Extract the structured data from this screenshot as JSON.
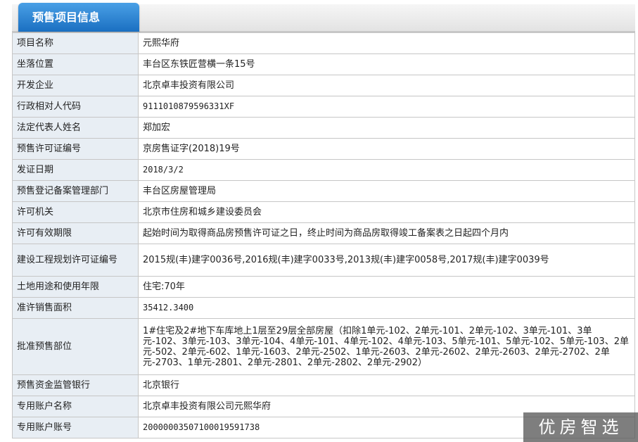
{
  "section": {
    "title": "预售项目信息"
  },
  "rows": [
    {
      "label": "项目名称",
      "value": "元熙华府"
    },
    {
      "label": "坐落位置",
      "value": "丰台区东铁匠营横一条15号"
    },
    {
      "label": "开发企业",
      "value": "北京卓丰投资有限公司"
    },
    {
      "label": "行政相对人代码",
      "value": "9111010879596331XF"
    },
    {
      "label": "法定代表人姓名",
      "value": "郑加宏"
    },
    {
      "label": "预售许可证编号",
      "value": "京房售证字(2018)19号"
    },
    {
      "label": "发证日期",
      "value": "2018/3/2"
    },
    {
      "label": "预售登记备案管理部门",
      "value": "丰台区房屋管理局"
    },
    {
      "label": "许可机关",
      "value": "北京市住房和城乡建设委员会"
    },
    {
      "label": "许可有效期限",
      "value": "起始时间为取得商品房预售许可证之日，终止时间为商品房取得竣工备案表之日起四个月内"
    },
    {
      "label": "建设工程规划许可证编号",
      "value": "2015规(丰)建字0036号,2016规(丰)建字0033号,2013规(丰)建字0058号,2017规(丰)建字0039号"
    },
    {
      "label": "土地用途和使用年限",
      "value": "住宅:70年"
    },
    {
      "label": "准许销售面积",
      "value": "35412.3400"
    },
    {
      "label": "批准预售部位",
      "value": "1#住宅及2#地下车库地上1层至29层全部房屋（扣除1单元-102、2单元-101、2单元-102、3单元-101、3单元-102、3单元-103、3单元-104、4单元-101、4单元-102、4单元-103、5单元-101、5单元-102、5单元-103、2单元-502、2单元-602、1单元-1603、2单元-2502、1单元-2603、2单元-2602、2单元-2603、2单元-2702、2单元-2703、1单元-2801、2单元-2801、2单元-2802、2单元-2902）"
    },
    {
      "label": "预售资金监管银行",
      "value": "北京银行"
    },
    {
      "label": "专用账户名称",
      "value": "北京卓丰投资有限公司元熙华府"
    },
    {
      "label": "专用账户账号",
      "value": "20000003507100019591738"
    }
  ],
  "watermark": "优房智选"
}
